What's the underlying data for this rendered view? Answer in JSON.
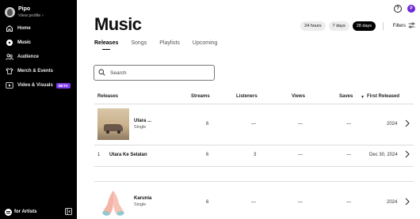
{
  "sidebar": {
    "profile_name": "Pipo",
    "profile_link": "View profile ›",
    "items": [
      {
        "label": "Home",
        "icon": "home-icon"
      },
      {
        "label": "Music",
        "icon": "music-disc-icon"
      },
      {
        "label": "Audience",
        "icon": "audience-icon"
      },
      {
        "label": "Merch & Events",
        "icon": "merch-icon"
      },
      {
        "label": "Video & Visuals",
        "icon": "video-icon",
        "badge": "BETA"
      }
    ],
    "footer_brand": "for Artists"
  },
  "header": {
    "help": "?",
    "user_initial": "P",
    "title": "Music",
    "ranges": [
      "24 hours",
      "7 days",
      "28 days"
    ],
    "active_range": "28 days",
    "filters_label": "Filters"
  },
  "tabs": [
    "Releases",
    "Songs",
    "Playlists",
    "Upcoming"
  ],
  "search": {
    "placeholder": "Search"
  },
  "table": {
    "headers": [
      "Releases",
      "Streams",
      "Listeners",
      "Views",
      "Saves",
      "First Released"
    ],
    "sort_indicator": "▼",
    "rows": [
      {
        "title": "Utara ...",
        "subtitle": "Single",
        "streams": "6",
        "listeners": "—",
        "views": "—",
        "saves": "—",
        "released": "2024",
        "cover": "car-cover"
      },
      {
        "index": "1",
        "title": "Utara Ke Selatan",
        "streams": "6",
        "listeners": "3",
        "views": "—",
        "saves": "—",
        "released": "Dec 30, 2024"
      },
      {
        "title": "Karunia",
        "subtitle": "Single",
        "streams": "6",
        "listeners": "—",
        "views": "—",
        "saves": "—",
        "released": "2024",
        "cover": "hands-cover"
      }
    ]
  },
  "colors": {
    "accent": "#7c3aed",
    "sidebar_bg": "#000000",
    "chip_active": "#000000"
  }
}
